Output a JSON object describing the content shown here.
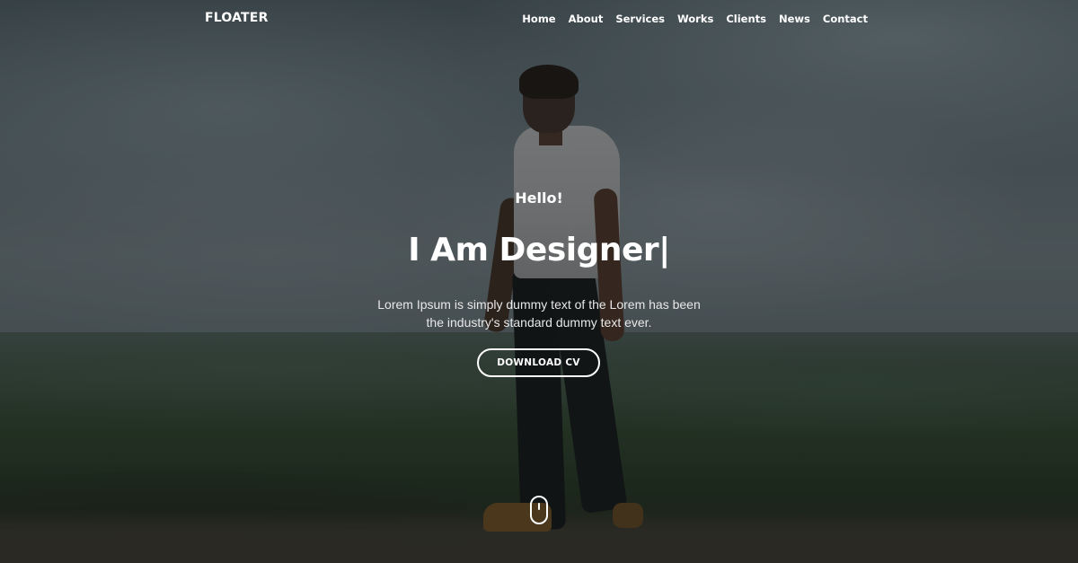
{
  "brand": "FLOATER",
  "nav": {
    "items": [
      "Home",
      "About",
      "Services",
      "Works",
      "Clients",
      "News",
      "Contact"
    ]
  },
  "hero": {
    "greeting": "Hello!",
    "headline": "I Am Designer",
    "cursor": "|",
    "description": "Lorem Ipsum is simply dummy text of the Lorem has been the industry's standard dummy text ever.",
    "cta_label": "DOWNLOAD CV"
  },
  "colors": {
    "text": "#ffffff",
    "overlay": "#0f1416"
  },
  "icons": {
    "scroll": "mouse-scroll-icon"
  }
}
